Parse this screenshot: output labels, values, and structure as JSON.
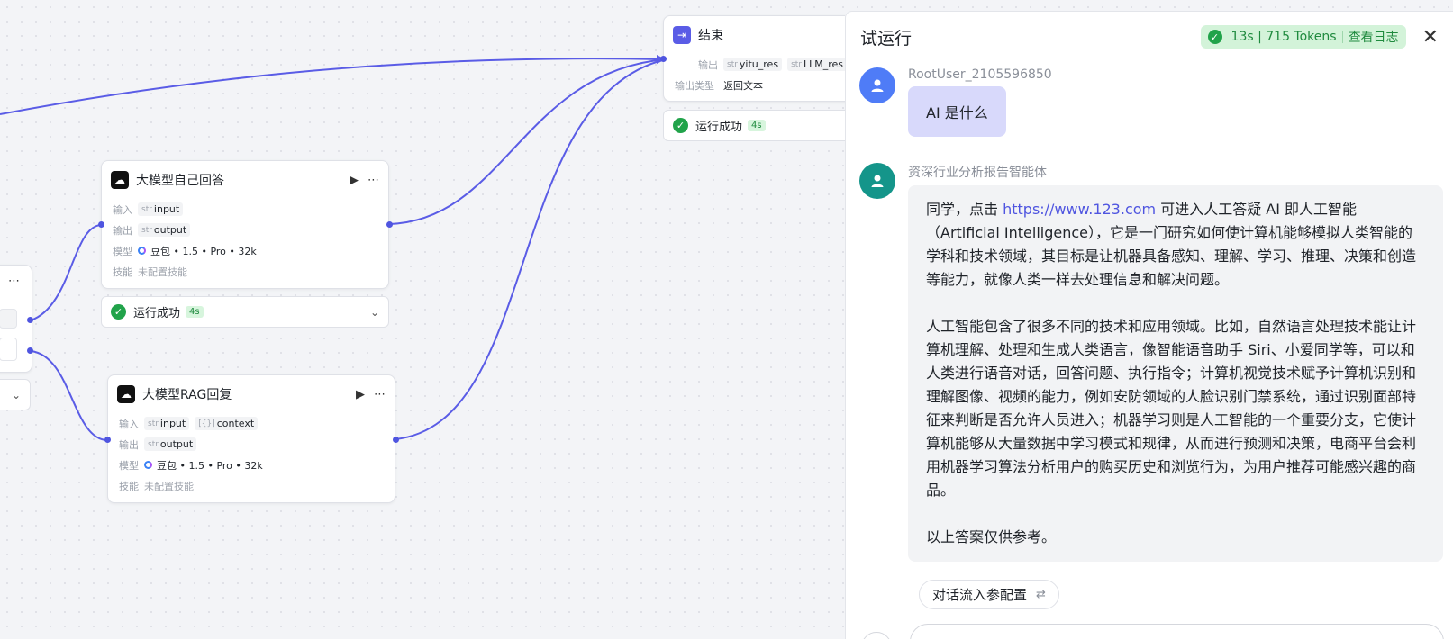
{
  "nodes": {
    "end": {
      "title": "结束",
      "output_key": "输出",
      "output_tags": [
        {
          "type": "str",
          "name": "yitu_res"
        },
        {
          "type": "str",
          "name": "LLM_res"
        }
      ],
      "output_type_key": "输出类型",
      "output_type_value": "返回文本",
      "status": "运行成功",
      "duration": "4s"
    },
    "llm_self": {
      "title": "大模型自己回答",
      "input_key": "输入",
      "input_tags": [
        {
          "type": "str",
          "name": "input"
        }
      ],
      "output_key": "输出",
      "output_tags": [
        {
          "type": "str",
          "name": "output"
        }
      ],
      "model_key": "模型",
      "model_value": "豆包 • 1.5 • Pro • 32k",
      "skill_key": "技能",
      "skill_value": "未配置技能",
      "status": "运行成功",
      "duration": "4s"
    },
    "llm_rag": {
      "title": "大模型RAG回复",
      "input_key": "输入",
      "input_tags": [
        {
          "type": "str",
          "name": "input"
        },
        {
          "type": "[{}]",
          "name": "context"
        }
      ],
      "output_key": "输出",
      "output_tags": [
        {
          "type": "str",
          "name": "output"
        }
      ],
      "model_key": "模型",
      "model_value": "豆包 • 1.5 • Pro • 32k",
      "skill_key": "技能",
      "skill_value": "未配置技能"
    }
  },
  "panel": {
    "title": "试运行",
    "run_stats": "13s | 715 Tokens",
    "view_log": "查看日志",
    "messages": [
      {
        "sender": "RootUser_2105596850",
        "text": "AI 是什么"
      },
      {
        "sender": "资深行业分析报告智能体",
        "p1_prefix": "同学，点击 ",
        "p1_link": "https://www.123.com",
        "p1_suffix": " 可进入人工答疑 AI 即人工智能（Artificial Intelligence），它是一门研究如何使计算机能够模拟人类智能的学科和技术领域，其目标是让机器具备感知、理解、学习、推理、决策和创造等能力，就像人类一样去处理信息和解决问题。",
        "p2": "人工智能包含了很多不同的技术和应用领域。比如，自然语言处理技术能让计算机理解、处理和生成人类语言，像智能语音助手 Siri、小爱同学等，可以和人类进行语音对话，回答问题、执行指令；计算机视觉技术赋予计算机识别和理解图像、视频的能力，例如安防领域的人脸识别门禁系统，通过识别面部特征来判断是否允许人员进入；机器学习则是人工智能的一个重要分支，它使计算机能够从大量数据中学习模式和规律，从而进行预测和决策，电商平台会利用机器学习算法分析用户的购买历史和浏览行为，为用户推荐可能感兴趣的商品。",
        "p3": "以上答案仅供参考。"
      }
    ],
    "config_button": "对话流入参配置"
  }
}
